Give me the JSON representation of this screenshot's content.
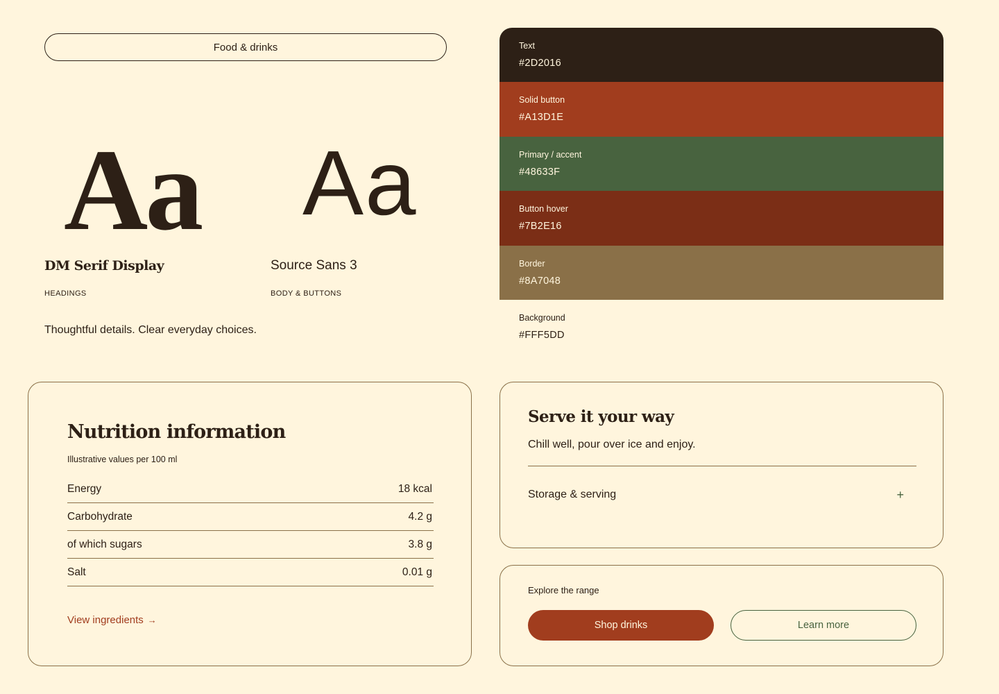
{
  "brand": {
    "category_pill": "Food & drinks",
    "specimen_serif": "Aa",
    "specimen_sans": "Aa",
    "fonts": [
      {
        "name": "DM Serif Display",
        "role": "HEADINGS"
      },
      {
        "name": "Source Sans 3",
        "role": "BODY & BUTTONS"
      }
    ],
    "tagline": "Thoughtful details. Clear everyday choices."
  },
  "palette": [
    {
      "label": "Text",
      "hex": "#2D2016"
    },
    {
      "label": "Solid button",
      "hex": "#A13D1E"
    },
    {
      "label": "Primary / accent",
      "hex": "#48633F"
    },
    {
      "label": "Button hover",
      "hex": "#7B2E16"
    },
    {
      "label": "Border",
      "hex": "#8A7048"
    },
    {
      "label": "Background",
      "hex": "#FFF5DD"
    }
  ],
  "nutrition": {
    "title": "Nutrition information",
    "subtitle": "Illustrative values per 100 ml",
    "rows": [
      {
        "name": "Energy",
        "value": "18 kcal"
      },
      {
        "name": "Carbohydrate",
        "value": "4.2 g"
      },
      {
        "name": "of which sugars",
        "value": "3.8 g"
      },
      {
        "name": "Salt",
        "value": "0.01 g"
      }
    ],
    "link_label": "View ingredients",
    "link_icon": "arrow-right-icon"
  },
  "serve": {
    "title": "Serve it your way",
    "subtitle": "Chill well, pour over ice and enjoy.",
    "accordion_label": "Storage & serving",
    "accordion_icon": "plus-icon"
  },
  "explore": {
    "label": "Explore the range",
    "primary_button": "Shop drinks",
    "secondary_button": "Learn more"
  }
}
